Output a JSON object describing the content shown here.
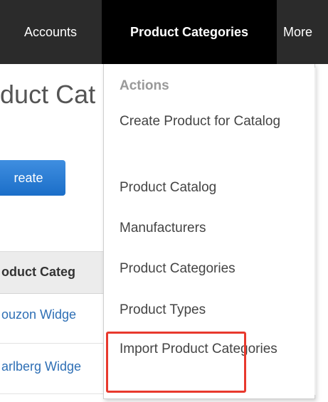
{
  "nav": {
    "accounts": "Accounts",
    "product_categories": "Product Categories",
    "more": "More"
  },
  "page": {
    "title": "oduct Cat",
    "create_label": "reate"
  },
  "table": {
    "header": "oduct Categ",
    "rows": [
      {
        "name": "ouzon Widge"
      },
      {
        "name": "arlberg Widge"
      }
    ]
  },
  "dropdown": {
    "header": "Actions",
    "items": [
      {
        "label": "Create Product for Catalog"
      },
      {
        "label": "Product Catalog"
      },
      {
        "label": "Manufacturers"
      },
      {
        "label": "Product Categories"
      },
      {
        "label": "Product Types"
      },
      {
        "label": "Import Product Categories"
      }
    ]
  },
  "colors": {
    "topbar": "#2b2b2b",
    "active_tab": "#000000",
    "link": "#2e6fb5",
    "button": "#1b6ec8",
    "highlight": "#e8392d"
  }
}
